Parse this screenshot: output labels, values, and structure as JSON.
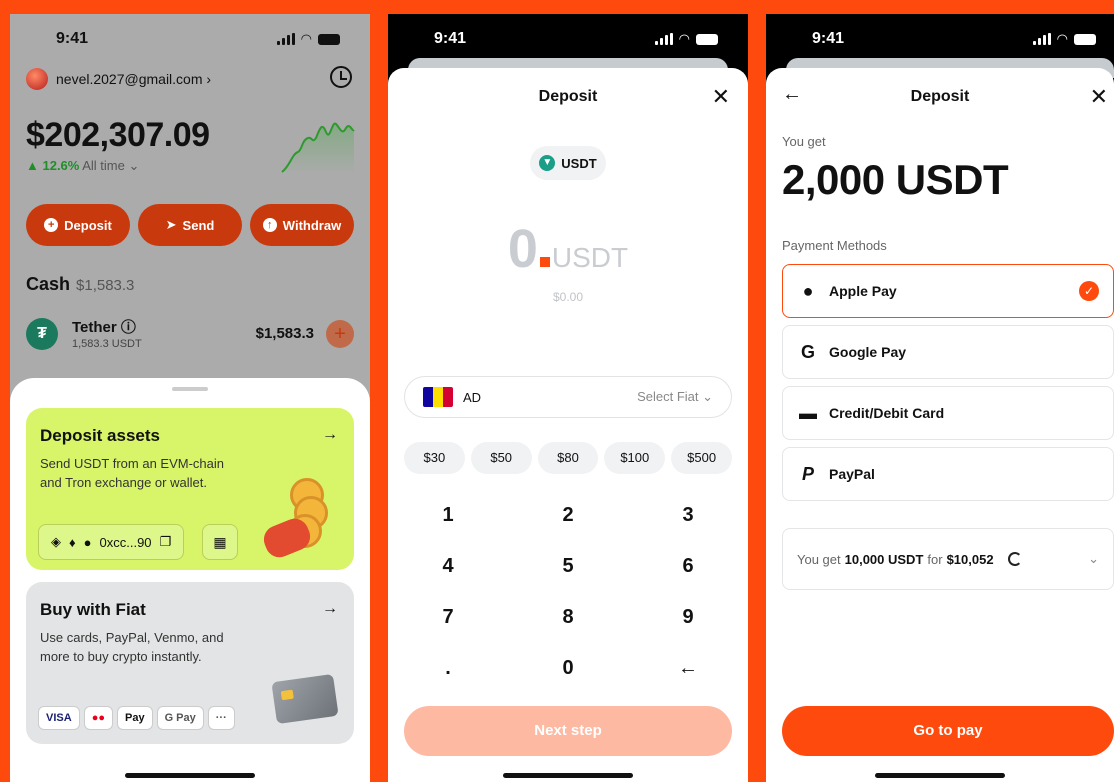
{
  "status": {
    "time": "9:41"
  },
  "wallet": {
    "email": "nevel.2027@gmail.com ›",
    "balance": "$202,307.09",
    "change_pct": "▲ 12.6%",
    "change_period": "All time ⌄",
    "actions": [
      "Deposit",
      "Send",
      "Withdraw"
    ],
    "cash_label": "Cash",
    "cash_amount": "$1,583.3",
    "asset": {
      "name": "Tether ⓘ",
      "sub": "1,583.3 USDT",
      "value": "$1,583.3"
    },
    "deposit_card": {
      "title": "Deposit assets",
      "desc": "Send USDT from an EVM-chain and Tron exchange or wallet.",
      "address": "0xcc...90"
    },
    "fiat_card": {
      "title": "Buy with Fiat",
      "desc": "Use cards, PayPal, Venmo, and more to buy crypto instantly.",
      "logos": [
        "VISA",
        "●●",
        "Pay",
        "G Pay",
        "···"
      ]
    }
  },
  "deposit": {
    "title": "Deposit",
    "token": "USDT",
    "amount": "0",
    "unit": "USDT",
    "usd": "$0.00",
    "country": "AD",
    "select_fiat": "Select Fiat ⌄",
    "presets": [
      "$30",
      "$50",
      "$80",
      "$100",
      "$500"
    ],
    "keys": [
      "1",
      "2",
      "3",
      "4",
      "5",
      "6",
      "7",
      "8",
      "9",
      ".",
      "0",
      "←"
    ],
    "next": "Next step"
  },
  "payment": {
    "title": "Deposit",
    "you_get_label": "You get",
    "you_get_amount": "2,000 USDT",
    "methods_label": "Payment Methods",
    "methods": [
      "Apple Pay",
      "Google Pay",
      "Credit/Debit Card",
      "PayPal"
    ],
    "quote_prefix": "You get",
    "quote_amount": "10,000 USDT",
    "quote_for": "for",
    "quote_price": "$10,052",
    "cta": "Go to pay"
  },
  "colors": {
    "brand": "#FF4A0D",
    "lime": "#D8F56A"
  }
}
